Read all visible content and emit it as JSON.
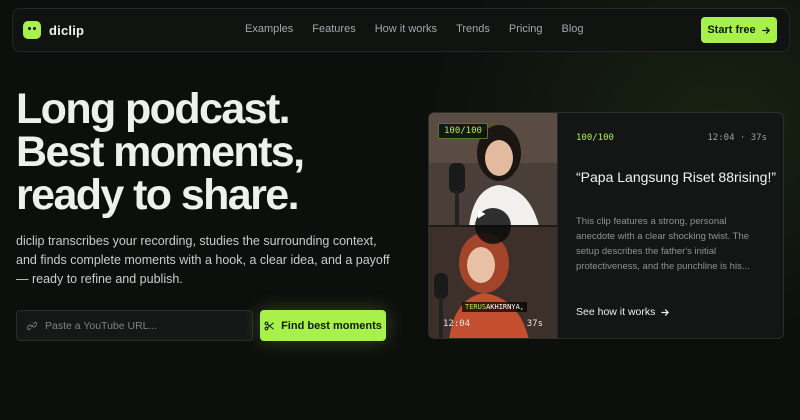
{
  "nav": {
    "brand": "diclip",
    "items": [
      "Examples",
      "Features",
      "How it works",
      "Trends",
      "Pricing",
      "Blog"
    ],
    "cta": "Start free"
  },
  "hero": {
    "headline": [
      "Long podcast.",
      "Best moments,",
      "ready to share."
    ],
    "subtext": "diclip transcribes your recording, studies the surrounding context, and finds complete moments with a hook, a clear idea, and a payoff — ready to refine and publish.",
    "input_placeholder": "Paste a YouTube URL...",
    "input_value": "",
    "find_button": "Find best moments"
  },
  "clip_card": {
    "thumb_score": "100/100",
    "caption_highlight": "TERUS",
    "caption_rest": "AKHIRNYA,",
    "thumb_start": "12:04",
    "thumb_duration": "37s",
    "score": "100/100",
    "time_range": "12:04 · 37s",
    "title": "“Papa Langsung Riset 88rising!”",
    "description": "This clip features a strong, personal anecdote with a clear shocking twist. The setup describes the father's initial protectiveness, and the punchline is his...",
    "link": "See how it works"
  },
  "colors": {
    "accent": "#a8f04a",
    "background": "#0d0f0d",
    "card": "#131614"
  }
}
